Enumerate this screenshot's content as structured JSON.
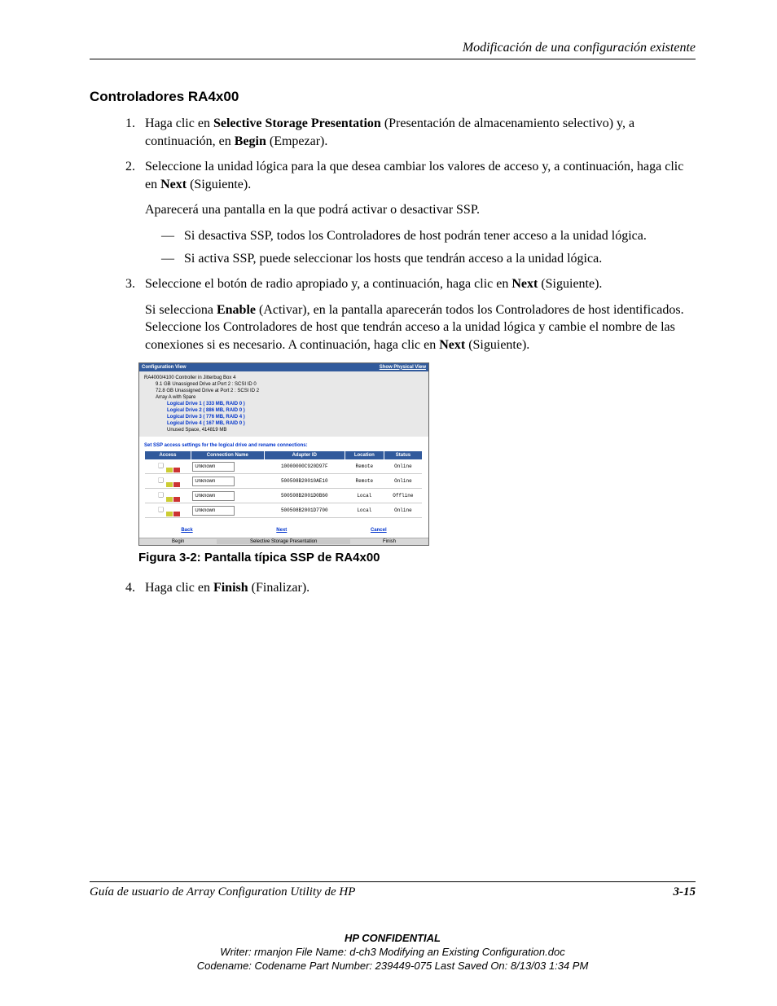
{
  "header": {
    "section": "Modificación de una configuración existente"
  },
  "title": "Controladores RA4x00",
  "step1": {
    "pre": "Haga clic en ",
    "b1": "Selective Storage Presentation",
    "mid": " (Presentación de almacenamiento selectivo) y, a continuación, en ",
    "b2": "Begin",
    "post": " (Empezar)."
  },
  "step2": {
    "line1a": "Seleccione la unidad lógica para la que desea cambiar los valores de acceso y, a continuación, haga clic en ",
    "line1b": "Next",
    "line1c": " (Siguiente).",
    "para": "Aparecerá una pantalla en la que podrá activar o desactivar SSP.",
    "dash1": "Si desactiva SSP, todos los Controladores de host podrán tener acceso a la unidad lógica.",
    "dash2": "Si activa SSP, puede seleccionar los hosts que tendrán acceso a la unidad lógica."
  },
  "step3": {
    "line1a": "Seleccione el botón de radio apropiado y, a continuación, haga clic en ",
    "line1b": "Next",
    "line1c": " (Siguiente).",
    "para_a": "Si selecciona ",
    "para_b": "Enable",
    "para_c": " (Activar), en la pantalla aparecerán todos los Controladores de host identificados. Seleccione los Controladores de host que tendrán acceso a la unidad lógica y cambie el nombre de las conexiones si es necesario. A continuación, haga clic en ",
    "para_d": "Next",
    "para_e": " (Siguiente)."
  },
  "screenshot": {
    "hdr_left": "Configuration View",
    "hdr_right": "Show Physical View",
    "tree": {
      "root": "RA4000/4100 Controller in Jitterbug Box 4",
      "d1": "9.1 GB Unassigned Drive at Port 2 : SCSI ID 0",
      "d2": "72.8 GB Unassigned Drive at Port 2 : SCSI ID 2",
      "array": "Array A with Spare",
      "ld1": "Logical Drive 1 ( 333 MB, RAID 0 )",
      "ld2": "Logical Drive 2 ( 886 MB, RAID 0 )",
      "ld3": "Logical Drive 3 ( 776 MB, RAID 4 )",
      "ld4": "Logical Drive 4 ( 167 MB, RAID 0 )",
      "unused": "Unused Space, 414819 MB"
    },
    "instr": "Set SSP access settings for the logical drive and rename connections:",
    "thead": {
      "access": "Access",
      "cname": "Connection Name",
      "adapter": "Adapter ID",
      "loc": "Location",
      "status": "Status"
    },
    "rows": [
      {
        "conn": "Unknown",
        "adapter": "10000000C920D97F",
        "loc": "Remote",
        "status": "Online"
      },
      {
        "conn": "Unknown",
        "adapter": "500508B20010AE10",
        "loc": "Remote",
        "status": "Online"
      },
      {
        "conn": "Unknown",
        "adapter": "500508B2001D0B60",
        "loc": "Local",
        "status": "Offline"
      },
      {
        "conn": "Unknown",
        "adapter": "500508B2001D7700",
        "loc": "Local",
        "status": "Online"
      }
    ],
    "nav": {
      "back": "Back",
      "next": "Next",
      "cancel": "Cancel"
    },
    "footer": {
      "begin": "Begin",
      "center": "Selective Storage Presentation",
      "finish": "Finish"
    }
  },
  "figcap": "Figura 3-2:  Pantalla típica SSP de RA4x00",
  "step4": {
    "a": "Haga clic en ",
    "b": "Finish",
    "c": " (Finalizar)."
  },
  "footer": {
    "left": "Guía de usuario de Array Configuration Utility de HP",
    "right": "3-15"
  },
  "confidential": {
    "l1": "HP CONFIDENTIAL",
    "l2": "Writer: rmanjon File Name: d-ch3 Modifying an Existing Configuration.doc",
    "l3": "Codename: Codename Part Number: 239449-075 Last Saved On: 8/13/03 1:34 PM"
  }
}
